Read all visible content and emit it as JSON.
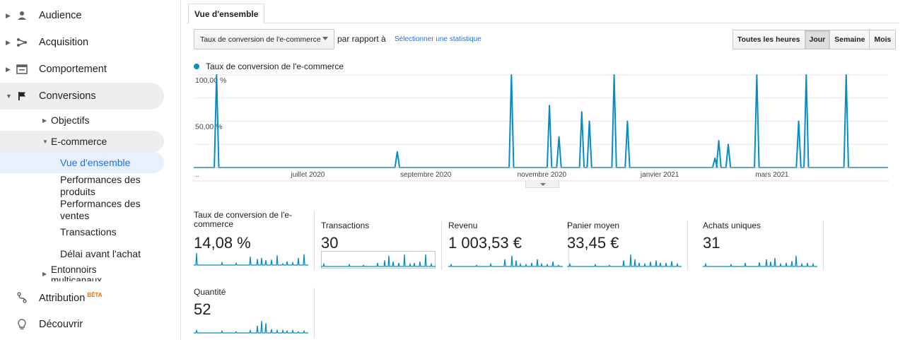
{
  "sidebar": {
    "items": [
      {
        "label": "Audience"
      },
      {
        "label": "Acquisition"
      },
      {
        "label": "Comportement"
      },
      {
        "label": "Conversions"
      }
    ],
    "conversions_sub": {
      "objectifs": "Objectifs",
      "ecommerce": "E-commerce",
      "ecommerce_children": [
        "Vue d'ensemble",
        "Performances des produits",
        "Performances des ventes",
        "Transactions",
        "Délai avant l'achat"
      ],
      "entonnoirs": "Entonnoirs multicanaux"
    },
    "attribution": {
      "label": "Attribution",
      "badge": "BÊTA"
    },
    "decouvrir": {
      "label": "Découvrir"
    }
  },
  "tabs": [
    {
      "label": "Vue d'ensemble"
    }
  ],
  "controls": {
    "metric_select": "Taux de conversion de l'e-commerce",
    "compare_label": "par rapport à",
    "select_stat": "Sélectionner une statistique",
    "ranges": [
      "Toutes les heures",
      "Jour",
      "Semaine",
      "Mois"
    ],
    "selected_range": "Jour"
  },
  "chart_data": {
    "type": "line",
    "series": [
      {
        "name": "Taux de conversion de l'e-commerce",
        "color": "#058dc7"
      }
    ],
    "y_ticks": [
      "100,00 %",
      "50,00 %"
    ],
    "ylim": [
      0,
      100
    ],
    "x_start_label": "..",
    "x_labels": [
      "juillet 2020",
      "septembre 2020",
      "novembre 2020",
      "janvier 2021",
      "mars 2021"
    ],
    "x_label_days": [
      60,
      122,
      183,
      245,
      304
    ],
    "x_range_days": [
      0,
      365
    ],
    "spikes": [
      {
        "day": 12,
        "value": 100
      },
      {
        "day": 107,
        "value": 17
      },
      {
        "day": 167,
        "value": 100
      },
      {
        "day": 187,
        "value": 67
      },
      {
        "day": 192,
        "value": 33
      },
      {
        "day": 204,
        "value": 60
      },
      {
        "day": 208,
        "value": 50
      },
      {
        "day": 221,
        "value": 100
      },
      {
        "day": 228,
        "value": 50
      },
      {
        "day": 274,
        "value": 10
      },
      {
        "day": 276,
        "value": 29
      },
      {
        "day": 281,
        "value": 25
      },
      {
        "day": 296,
        "value": 100
      },
      {
        "day": 318,
        "value": 50
      },
      {
        "day": 322,
        "value": 100
      },
      {
        "day": 343,
        "value": 100
      }
    ]
  },
  "scorecards": [
    {
      "name": "Taux de conversion de l'e-commerce",
      "value": "14,08 %"
    },
    {
      "name": "Transactions",
      "value": "30"
    },
    {
      "name": "Revenu",
      "value": "1 003,53 €"
    },
    {
      "name": "Panier moyen",
      "value": "33,45 €"
    },
    {
      "name": "Achats uniques",
      "value": "31"
    },
    {
      "name": "Quantité",
      "value": "52"
    }
  ]
}
